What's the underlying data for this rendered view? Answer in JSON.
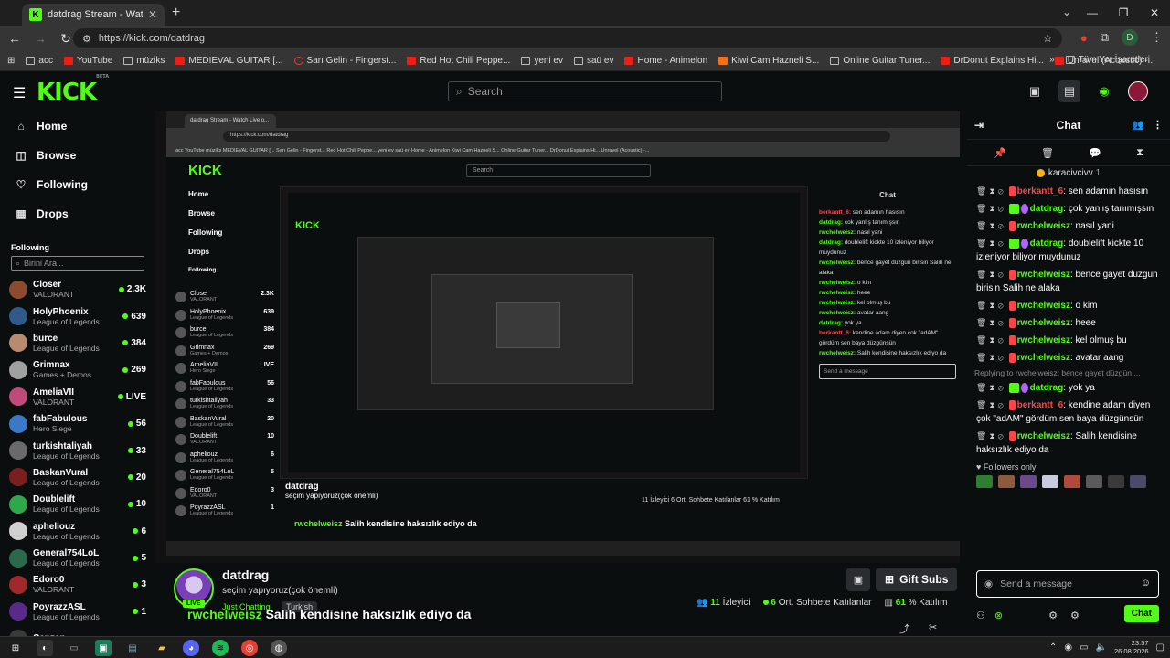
{
  "browser": {
    "tab_title": "datdrag Stream - Watch Live o",
    "url": "https://kick.com/datdrag",
    "profile_initial": "D",
    "bookmarks": [
      "acc",
      "YouTube",
      "müziks",
      "MEDIEVAL GUITAR [...",
      "Sarı Gelin - Fingerst...",
      "Red Hot Chili Peppe...",
      "yeni ev",
      "saü ev",
      "Home - Animelon",
      "Kiwi Cam Hazneli S...",
      "Online Guitar Tuner...",
      "DrDonut Explains Hi...",
      "Unravel (Acoustic) -..."
    ],
    "bookmarks_all": "Tüm Yer İşaretleri"
  },
  "header": {
    "logo": "KICK",
    "logo_beta": "BETA",
    "search_placeholder": "Search"
  },
  "sidebar": {
    "nav": [
      {
        "label": "Home",
        "icon": "home-icon"
      },
      {
        "label": "Browse",
        "icon": "browse-icon"
      },
      {
        "label": "Following",
        "icon": "heart-icon"
      },
      {
        "label": "Drops",
        "icon": "drops-icon"
      }
    ],
    "following_title": "Following",
    "following_search_placeholder": "Birini Ara...",
    "following": [
      {
        "name": "Closer",
        "category": "VALORANT",
        "count": "2.3K",
        "color": "#8a4b2f"
      },
      {
        "name": "HolyPhoenix",
        "category": "League of Legends",
        "count": "639",
        "color": "#2f5a8a"
      },
      {
        "name": "burce",
        "category": "League of Legends",
        "count": "384",
        "color": "#b98a70"
      },
      {
        "name": "Grimnax",
        "category": "Games + Demos",
        "count": "269",
        "color": "#a0a0a0"
      },
      {
        "name": "AmeliaVII",
        "category": "VALORANT",
        "count": "LIVE",
        "color": "#c04a7a"
      },
      {
        "name": "fabFabulous",
        "category": "Hero Siege",
        "count": "56",
        "color": "#3a78c8"
      },
      {
        "name": "turkishtaliyah",
        "category": "League of Legends",
        "count": "33",
        "color": "#6a6a6a"
      },
      {
        "name": "BaskanVural",
        "category": "League of Legends",
        "count": "20",
        "color": "#7a1f1f"
      },
      {
        "name": "Doublelift",
        "category": "League of Legends",
        "count": "10",
        "color": "#2fa84a"
      },
      {
        "name": "apheliouz",
        "category": "League of Legends",
        "count": "6",
        "color": "#d0d0d0"
      },
      {
        "name": "General754LoL",
        "category": "League of Legends",
        "count": "5",
        "color": "#2a6a4a"
      },
      {
        "name": "Edoro0",
        "category": "VALORANT",
        "count": "3",
        "color": "#a02a2a"
      },
      {
        "name": "PoyrazzASL",
        "category": "League of Legends",
        "count": "1",
        "color": "#5a2a8a"
      },
      {
        "name": "Canzep",
        "category": "",
        "count": "",
        "color": "#3a3a3a"
      }
    ]
  },
  "stream": {
    "name": "datdrag",
    "title": "seçim yapıyoruz(çok önemli)",
    "category": "Just Chatting",
    "tag": "Turkish",
    "live": "LIVE",
    "gift_label": "Gift Subs",
    "viewers_num": "11",
    "viewers_label": "İzleyici",
    "avg_num": "6",
    "avg_label": "Ort. Sohbete Katılanlar",
    "pct_num": "61",
    "pct_label": "% Katılım",
    "overlay_user": "rwchelweisz",
    "overlay_text": "Salih kendisine haksızlık ediyo da"
  },
  "chat": {
    "title": "Chat",
    "pinned_user": "karacivcivv",
    "pinned_count": "1",
    "messages": [
      {
        "user": "berkantt_6",
        "color": "#ff4545",
        "badges": [
          "red"
        ],
        "text": "sen adamın hasısın"
      },
      {
        "user": "datdrag",
        "color": "#53fc18",
        "badges": [
          "green",
          "purple"
        ],
        "text": "çok yanlış tanımışsın"
      },
      {
        "user": "rwchelweisz",
        "color": "#53fc18",
        "badges": [
          "red"
        ],
        "text": "nasıl yani"
      },
      {
        "user": "datdrag",
        "color": "#53fc18",
        "badges": [
          "green",
          "purple"
        ],
        "text": "doublelift kickte 10 izleniyor biliyor muydunuz"
      },
      {
        "user": "rwchelweisz",
        "color": "#53fc18",
        "badges": [
          "red"
        ],
        "text": "bence gayet düzgün birisin Salih ne alaka"
      },
      {
        "user": "rwchelweisz",
        "color": "#53fc18",
        "badges": [
          "red"
        ],
        "text": "o kim"
      },
      {
        "user": "rwchelweisz",
        "color": "#53fc18",
        "badges": [
          "red"
        ],
        "text": "heee"
      },
      {
        "user": "rwchelweisz",
        "color": "#53fc18",
        "badges": [
          "red"
        ],
        "text": "kel olmuş bu"
      },
      {
        "user": "rwchelweisz",
        "color": "#53fc18",
        "badges": [
          "red"
        ],
        "text": "avatar aang"
      }
    ],
    "reply_note": "Replying to rwchelweisz: bence gayet düzgün ...",
    "messages2": [
      {
        "user": "datdrag",
        "color": "#53fc18",
        "badges": [
          "green",
          "purple"
        ],
        "text": "yok ya"
      },
      {
        "user": "berkantt_6",
        "color": "#ff4545",
        "badges": [
          "red"
        ],
        "text": "kendine adam diyen çok \"adAM\" gördüm sen baya düzgünsün"
      },
      {
        "user": "rwchelweisz",
        "color": "#53fc18",
        "badges": [
          "red"
        ],
        "text": "Salih kendisine haksızlık ediyo da"
      }
    ],
    "followers_only": "Followers only",
    "input_placeholder": "Send a message",
    "send_label": "Chat"
  },
  "nested": {
    "tab_title": "datdrag Stream - Watch Live o...",
    "url": "https://kick.com/datdrag",
    "bookmarks_text": "acc   YouTube   müziks   MEDIEVAL GUITAR [...   Sarı Gelin - Fingerst...   Red Hot Chili Peppe...   yeni ev   saü ev   Home - Animelon   Kiwi Cam Hazneli S...   Online Guitar Tuner...   DrDonut Explains Hi...   Unravel (Acoustic) -...",
    "search": "Search",
    "nav": [
      "Home",
      "Browse",
      "Following",
      "Drops"
    ],
    "following_title": "Following",
    "following": [
      {
        "n": "Closer",
        "g": "VALORANT",
        "c": "2.3K"
      },
      {
        "n": "HolyPhoenix",
        "g": "League of Legends",
        "c": "639"
      },
      {
        "n": "burce",
        "g": "League of Legends",
        "c": "384"
      },
      {
        "n": "Grimnax",
        "g": "Games + Demos",
        "c": "269"
      },
      {
        "n": "AmeliaVII",
        "g": "Hero Siege",
        "c": "LIVE"
      },
      {
        "n": "fabFabulous",
        "g": "League of Legends",
        "c": "56"
      },
      {
        "n": "turkishtaliyah",
        "g": "League of Legends",
        "c": "33"
      },
      {
        "n": "BaskanVural",
        "g": "League of Legends",
        "c": "20"
      },
      {
        "n": "Doublelift",
        "g": "VALORANT",
        "c": "10"
      },
      {
        "n": "apheliouz",
        "g": "League of Legends",
        "c": "6"
      },
      {
        "n": "General754LoL",
        "g": "League of Legends",
        "c": "5"
      },
      {
        "n": "Edoro0",
        "g": "VALORANT",
        "c": "3"
      },
      {
        "n": "PoyrazzASL",
        "g": "League of Legends",
        "c": "1"
      }
    ],
    "chat_title": "Chat",
    "chat_lines": [
      {
        "u": "berkantt_6:",
        "t": "sen adamın hasısın",
        "cls": "u"
      },
      {
        "u": "datdrag:",
        "t": "çok yanlış tanımışsın",
        "cls": "ug"
      },
      {
        "u": "rwchelweisz:",
        "t": "nasıl yani",
        "cls": "ug"
      },
      {
        "u": "datdrag:",
        "t": "doublelift kickte 10 izleniyor biliyor muydunuz",
        "cls": "ug"
      },
      {
        "u": "rwchelweisz:",
        "t": "bence gayet düzgün birisin Salih ne alaka",
        "cls": "ug"
      },
      {
        "u": "rwchelweisz:",
        "t": "o kim",
        "cls": "ug"
      },
      {
        "u": "rwchelweisz:",
        "t": "heee",
        "cls": "ug"
      },
      {
        "u": "rwchelweisz:",
        "t": "kel olmuş bu",
        "cls": "ug"
      },
      {
        "u": "rwchelweisz:",
        "t": "avatar aang",
        "cls": "ug"
      },
      {
        "u": "datdrag:",
        "t": "yok ya",
        "cls": "ug"
      },
      {
        "u": "berkantt_6:",
        "t": "kendine adam diyen çok \"adAM\" gördüm sen baya düzgünsün",
        "cls": "u"
      },
      {
        "u": "rwchelweisz:",
        "t": "Salih kendisine haksızlık ediyo da",
        "cls": "ug"
      }
    ],
    "send_placeholder": "Send a message",
    "stream_name": "datdrag",
    "stream_title": "seçim yapıyoruz(çok önemli)",
    "stats": "11 İzleyici   6 Ort. Sohbete Katılanlar   61 % Katılım",
    "overlay_user": "rwchelweisz",
    "overlay_text": "Salih kendisine haksızlık ediyo da"
  },
  "taskbar": {
    "time": "23:57",
    "date": "26.08.2026"
  }
}
